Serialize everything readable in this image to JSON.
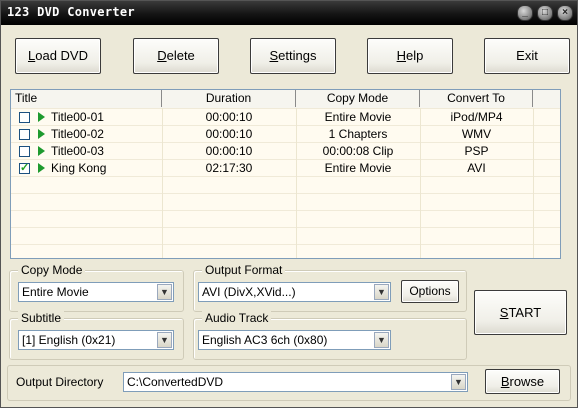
{
  "window": {
    "title": "123 DVD Converter",
    "minimize_glyph": "_",
    "maximize_glyph": "□",
    "close_glyph": "×"
  },
  "toolbar": {
    "load_dvd": {
      "mnemonic": "L",
      "rest": "oad DVD"
    },
    "delete": {
      "mnemonic": "D",
      "rest": "elete"
    },
    "settings": {
      "mnemonic": "S",
      "rest": "ettings"
    },
    "help": {
      "mnemonic": "H",
      "rest": "elp"
    },
    "exit": "Exit"
  },
  "list": {
    "columns": [
      "Title",
      "Duration",
      "Copy Mode",
      "Convert To"
    ],
    "rows": [
      {
        "checked": false,
        "title": "Title00-01",
        "duration": "00:00:10",
        "copy_mode": "Entire Movie",
        "convert_to": "iPod/MP4"
      },
      {
        "checked": false,
        "title": "Title00-02",
        "duration": "00:00:10",
        "copy_mode": "1 Chapters",
        "convert_to": "WMV"
      },
      {
        "checked": false,
        "title": "Title00-03",
        "duration": "00:00:10",
        "copy_mode": "00:00:08 Clip",
        "convert_to": "PSP"
      },
      {
        "checked": true,
        "title": "King Kong",
        "duration": "02:17:30",
        "copy_mode": "Entire Movie",
        "convert_to": "AVI"
      }
    ]
  },
  "copy_mode": {
    "label": "Copy Mode",
    "value": "Entire Movie"
  },
  "output_format": {
    "label": "Output Format",
    "value": "AVI (DivX,XVid...)",
    "options_button": "Options"
  },
  "subtitle": {
    "label": "Subtitle",
    "value": "[1] English (0x21)"
  },
  "audio_track": {
    "label": "Audio Track",
    "value": "English AC3 6ch (0x80)"
  },
  "start_button": {
    "mnemonic": "S",
    "rest": "TART"
  },
  "output_directory": {
    "label": "Output Directory",
    "value": "C:\\ConvertedDVD",
    "browse": {
      "mnemonic": "B",
      "rest": "rowse"
    }
  },
  "icons": {
    "checkbox_check": "✓",
    "dropdown": "▼"
  },
  "colors": {
    "titlebar": "#141414",
    "play_icon": "#1e9a2e",
    "list_bg": "#fffbf0"
  }
}
